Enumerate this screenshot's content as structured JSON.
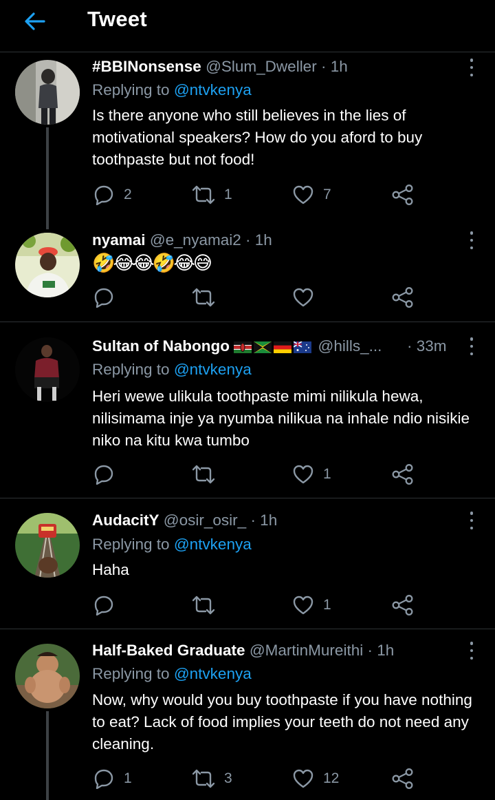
{
  "header": {
    "title": "Tweet"
  },
  "tweets": [
    {
      "display_name": "#BBINonsense",
      "handle": "@Slum_Dweller",
      "time": "· 1h",
      "replying_prefix": "Replying to ",
      "replying_to": "@ntvkenya",
      "text": "Is there anyone who still believes in the lies of motivational speakers? How do you aford to buy toothpaste but not food!",
      "replies": "2",
      "retweets": "1",
      "likes": "7"
    },
    {
      "display_name": "nyamai",
      "handle": "@e_nyamai2",
      "time": "· 1h",
      "text": "🤣😂😂🤣😂😅",
      "replies": "",
      "retweets": "",
      "likes": ""
    },
    {
      "display_name": "Sultan of Nabongo",
      "handle": "@hills_...",
      "time": "· 33m",
      "replying_prefix": "Replying to ",
      "replying_to": "@ntvkenya",
      "text": "Heri wewe ulikula toothpaste mimi nilikula hewa, nilisimama inje ya nyumba nilikua na inhale ndio nisikie niko na kitu kwa tumbo",
      "replies": "",
      "retweets": "",
      "likes": "1"
    },
    {
      "display_name": "AudacitY",
      "handle": "@osir_osir_",
      "time": "· 1h",
      "replying_prefix": "Replying to ",
      "replying_to": "@ntvkenya",
      "text": "Haha",
      "replies": "",
      "retweets": "",
      "likes": "1"
    },
    {
      "display_name": "Half-Baked Graduate",
      "handle": "@MartinMureithi",
      "time": "· 1h",
      "replying_prefix": "Replying to ",
      "replying_to": "@ntvkenya",
      "text": "Now, why would you buy toothpaste if you have nothing to eat? Lack of food implies your teeth do not need any cleaning.",
      "replies": "1",
      "retweets": "3",
      "likes": "12"
    }
  ],
  "colors": {
    "accent": "#1da1f2",
    "muted": "#8b98a5",
    "divider": "#2f3336",
    "background": "#000000"
  },
  "icons": [
    "back-arrow-icon",
    "more-icon",
    "reply-icon",
    "retweet-icon",
    "like-icon",
    "share-icon"
  ]
}
